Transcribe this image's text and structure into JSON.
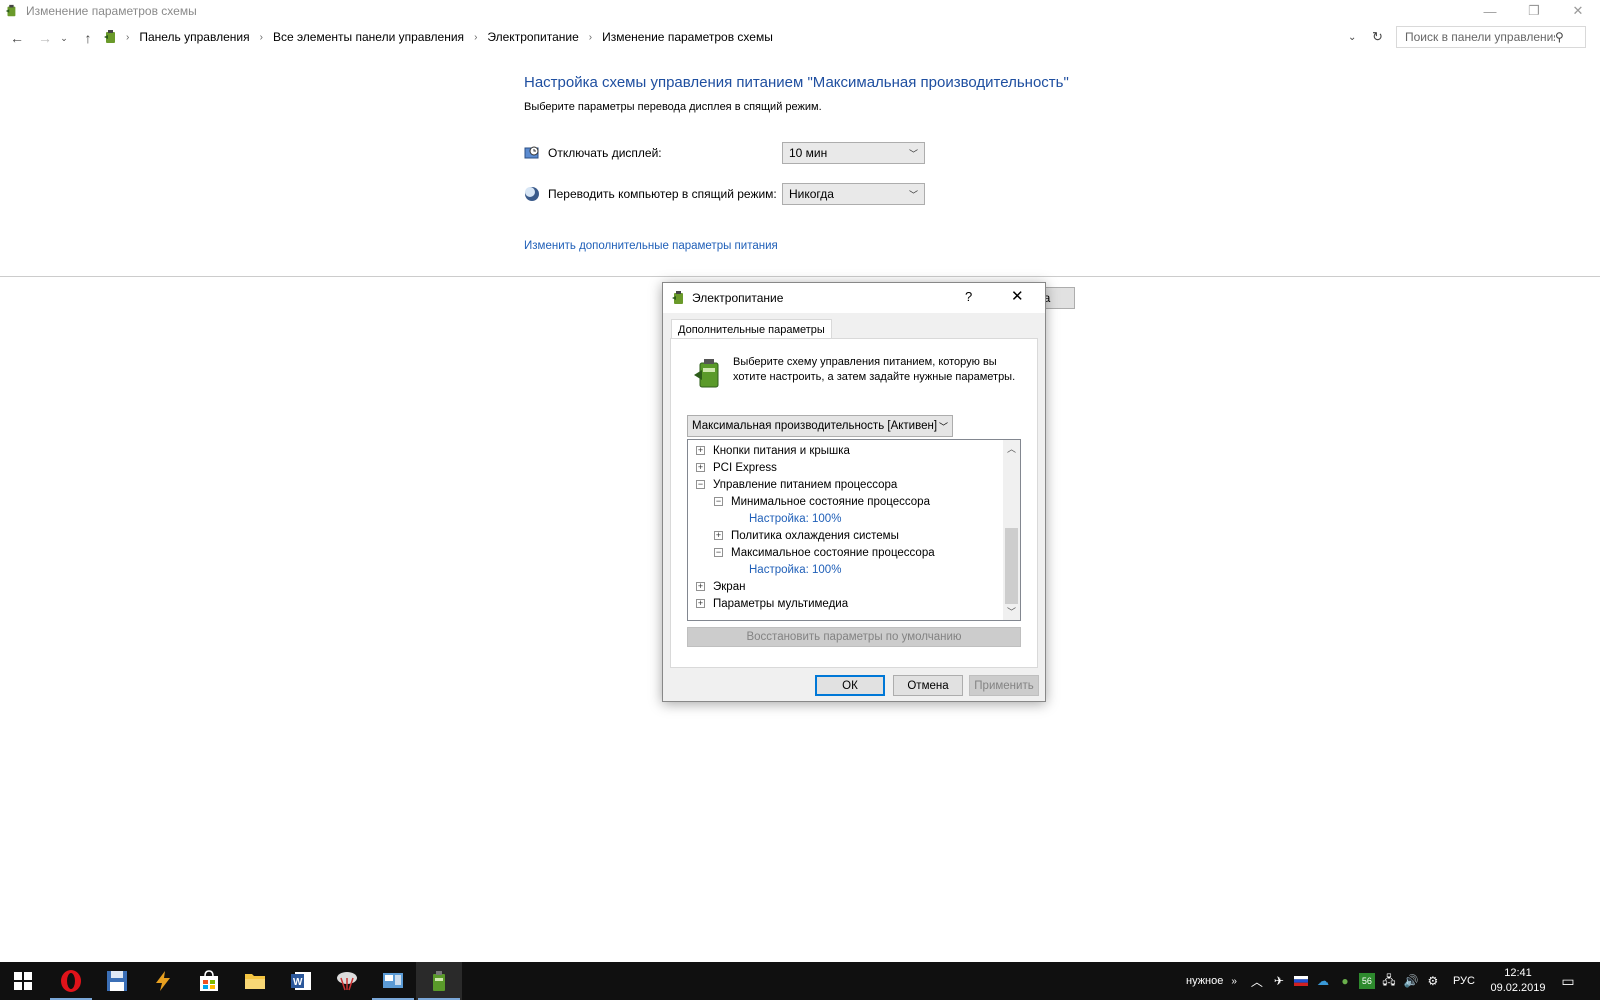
{
  "window": {
    "title": "Изменение параметров схемы"
  },
  "address": {
    "breadcrumbs": [
      "Панель управления",
      "Все элементы панели управления",
      "Электропитание",
      "Изменение параметров схемы"
    ],
    "search_placeholder": "Поиск в панели управления"
  },
  "main": {
    "heading": "Настройка схемы управления питанием \"Максимальная производительность\"",
    "subtitle": "Выберите параметры перевода дисплея в спящий режим.",
    "display_off": {
      "label": "Отключать дисплей:",
      "value": "10 мин"
    },
    "sleep": {
      "label": "Переводить компьютер в спящий режим:",
      "value": "Никогда"
    },
    "advanced_link": "Изменить дополнительные параметры питания",
    "partial_button": "на"
  },
  "dialog": {
    "title": "Электропитание",
    "help": "?",
    "tab": "Дополнительные параметры",
    "intro": "Выберите схему управления питанием, которую вы хотите настроить, а затем задайте нужные параметры.",
    "scheme": "Максимальная производительность [Активен]",
    "tree": [
      {
        "label": "Кнопки питания и крышка",
        "state": "+"
      },
      {
        "label": "PCI Express",
        "state": "+"
      },
      {
        "label": "Управление питанием процессора",
        "state": "−"
      },
      {
        "label": "Минимальное состояние процессора",
        "state": "−"
      },
      {
        "label": "Настройка: 100%"
      },
      {
        "label": "Политика охлаждения системы",
        "state": "+"
      },
      {
        "label": "Максимальное состояние процессора",
        "state": "−"
      },
      {
        "label": "Настройка: 100%"
      },
      {
        "label": "Экран",
        "state": "+"
      },
      {
        "label": "Параметры мультимедиа",
        "state": "+"
      }
    ],
    "restore_button": "Восстановить параметры по умолчанию",
    "ok": "ОК",
    "cancel": "Отмена",
    "apply": "Применить"
  },
  "taskbar": {
    "tray_label": "нужное",
    "badge": "56",
    "language": "РУС",
    "time": "12:41",
    "date": "09.02.2019"
  },
  "colors": {
    "heading": "#1f4fa0",
    "link": "#1f5fb8",
    "taskbar": "#101010",
    "focus": "#0078d7"
  }
}
